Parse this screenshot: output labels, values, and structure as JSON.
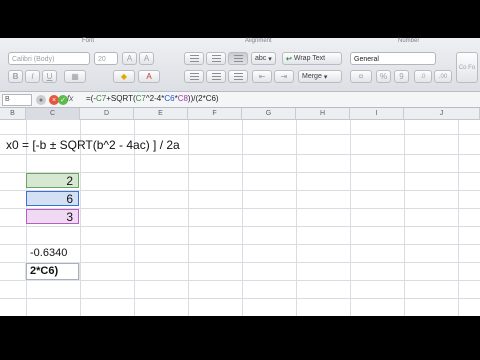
{
  "ribbon": {
    "font_group_label": "Font",
    "alignment_group_label": "Alignment",
    "number_group_label": "Number",
    "font_name": "Calibri (Body)",
    "font_size": "20",
    "bold": "B",
    "italic": "I",
    "underline": "U",
    "text_label": "abc",
    "wrap_text": "Wrap Text",
    "merge": "Merge",
    "number_format": "General",
    "percent": "%",
    "thousands": "9",
    "conditional_formatting": "Co Fo"
  },
  "formula_bar": {
    "cell_ref": "B",
    "fx": "fx",
    "formula_parts": [
      "=(-",
      "C7",
      "+SQRT(",
      "C7",
      "^2-4*",
      "C6",
      "*",
      "C8",
      "))/(2*C6)"
    ]
  },
  "columns": [
    "B",
    "C",
    "D",
    "E",
    "F",
    "G",
    "H",
    "I",
    "J"
  ],
  "sheet": {
    "equation_text": "x0 = [-b ± SQRT(b^2 - 4ac) ] / 2a",
    "values": [
      "2",
      "6",
      "3"
    ],
    "result": "-0.6340",
    "editing_text": "2*C6)"
  }
}
